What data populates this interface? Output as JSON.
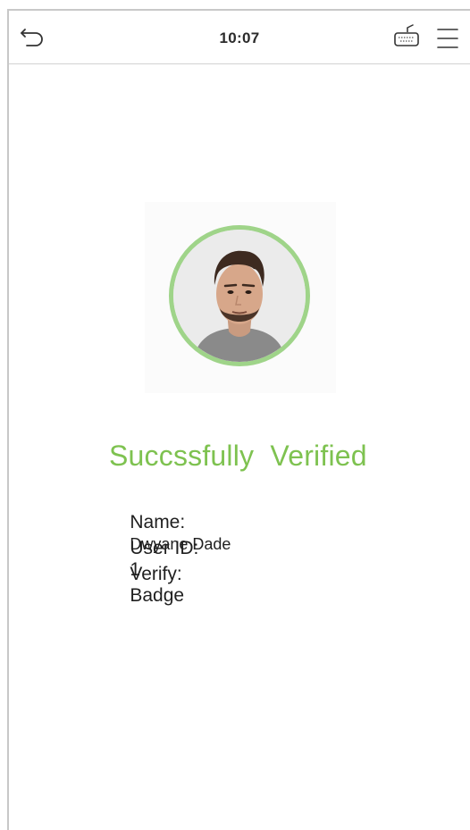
{
  "header": {
    "time": "10:07",
    "back_icon": "back-arrow-icon",
    "keyboard_icon": "keyboard-icon",
    "menu_icon": "hamburger-menu-icon"
  },
  "result": {
    "status_text": "Succssfully  Verified",
    "status_color": "#7ec250",
    "ring_color": "#9fd489",
    "photo_subject": "user-face-photo",
    "name_label": "Name:",
    "name_value": "Dwyane Dade",
    "user_id_label": "User ID:",
    "user_id_value": "1",
    "verify_label": "Verify:",
    "verify_value": "Badge"
  }
}
